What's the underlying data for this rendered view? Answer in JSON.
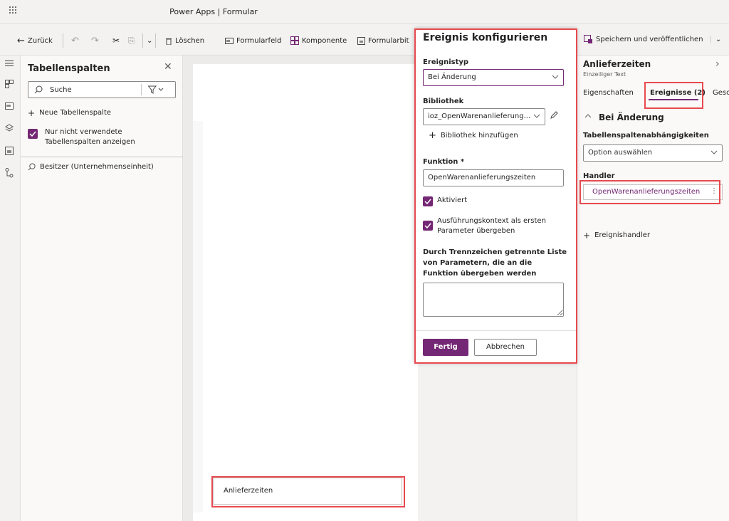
{
  "title_bar": {
    "app_title": "Power Apps | Formular"
  },
  "command_bar": {
    "back": "Zurück",
    "delete": "Löschen",
    "form_field": "Formularfeld",
    "component": "Komponente",
    "form_lib": "Formularbit",
    "save_publish": "Speichern und veröffentlichen"
  },
  "columns_panel": {
    "title": "Tabellenspalten",
    "search_placeholder": "Suche",
    "new_column": "Neue Tabellenspalte",
    "unused_only": "Nur nicht verwendete Tabellenspalten anzeigen",
    "owner_field": "Besitzer (Unternehmenseinheit)"
  },
  "canvas": {
    "field_label": "Anlieferzeiten"
  },
  "event_panel": {
    "title": "Ereignis konfigurieren",
    "event_type_label": "Ereignistyp",
    "event_type_value": "Bei Änderung",
    "library_label": "Bibliothek",
    "library_value": "ioz_OpenWarenanlieferung...",
    "add_library": "Bibliothek hinzufügen",
    "function_label": "Funktion *",
    "function_value": "OpenWarenanlieferungszeiten",
    "enabled_label": "Aktiviert",
    "context_label": "Ausführungskontext als ersten Parameter übergeben",
    "params_label": "Durch Trennzeichen getrennte Liste von Parametern, die an die Funktion übergeben werden",
    "done": "Fertig",
    "cancel": "Abbrechen"
  },
  "properties_panel": {
    "title": "Anlieferzeiten",
    "subtitle": "Einzeiliger Text",
    "tabs": [
      "Eigenschaften",
      "Ereignisse (2)",
      "Gesc"
    ],
    "section": "Bei Änderung",
    "deps_label": "Tabellenspaltenabhängigkeiten",
    "option_placeholder": "Option auswählen",
    "handler_label": "Handler",
    "handler_name": "OpenWarenanlieferungszeiten",
    "add_handler": "Ereignishandler"
  },
  "colors": {
    "accent": "#742774",
    "highlight": "#e74a4f"
  }
}
